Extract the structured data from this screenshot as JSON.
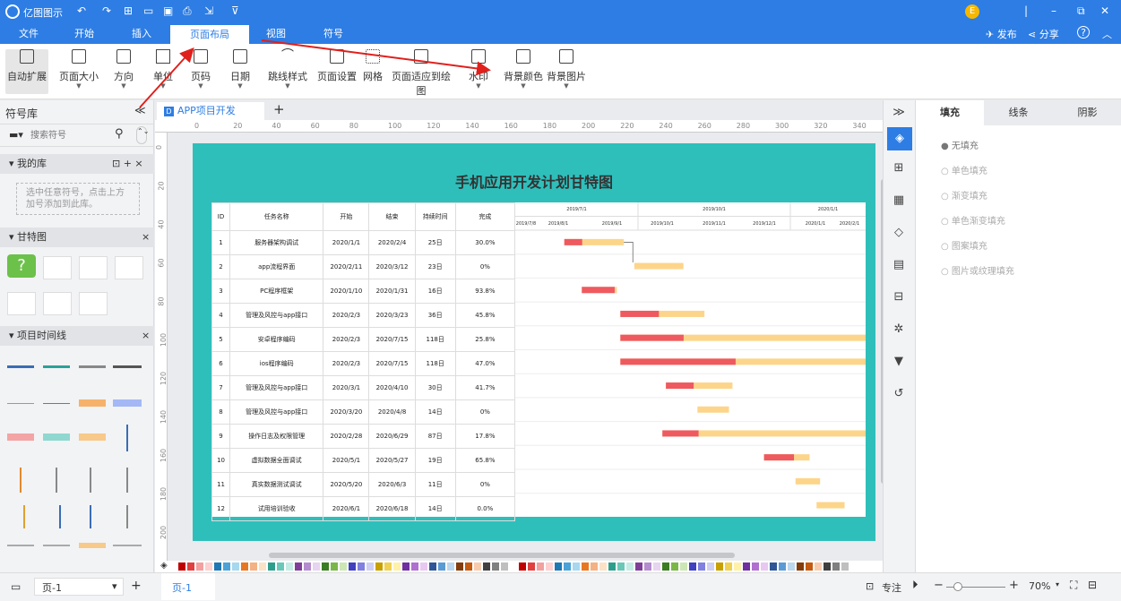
{
  "app": {
    "name": "亿图图示",
    "user_badge": "E",
    "publish": "发布",
    "share": "分享",
    "help": "?"
  },
  "tabs": [
    {
      "label": "文件"
    },
    {
      "label": "开始"
    },
    {
      "label": "插入"
    },
    {
      "label": "页面布局"
    },
    {
      "label": "视图"
    },
    {
      "label": "符号"
    }
  ],
  "ribbon": [
    {
      "label": "自动扩展"
    },
    {
      "label": "页面大小"
    },
    {
      "label": "方向"
    },
    {
      "label": "单位"
    },
    {
      "label": "页码"
    },
    {
      "label": "日期"
    },
    {
      "label": "跳线样式"
    },
    {
      "label": "页面设置"
    },
    {
      "label": "网格"
    },
    {
      "label": "页面适应到绘图"
    },
    {
      "label": "水印"
    },
    {
      "label": "背景颜色"
    },
    {
      "label": "背景图片"
    }
  ],
  "left_panel": {
    "title": "符号库",
    "search_placeholder": "搜索符号",
    "my_library": "我的库",
    "my_library_hint": "选中任意符号，点击上方加号添加到此库。",
    "gantt_section": "甘特图",
    "timeline_section": "项目时间线"
  },
  "doc_tab": "APP项目开发计...",
  "ruler_h": [
    "0",
    "20",
    "40",
    "60",
    "80",
    "100",
    "120",
    "140",
    "160",
    "180",
    "200",
    "220",
    "240",
    "260",
    "280",
    "300",
    "320",
    "340"
  ],
  "ruler_v": [
    "0",
    "20",
    "40",
    "60",
    "80",
    "100",
    "120",
    "140",
    "160",
    "180",
    "200"
  ],
  "gantt": {
    "title": "手机应用开发计划甘特图",
    "headers": [
      "ID",
      "任务名称",
      "开始",
      "结束",
      "持续时间",
      "完成"
    ],
    "top_periods": [
      "2019/7/1",
      "2019/10/1",
      "2020/1/1"
    ],
    "sub_periods": [
      "2019/7/8",
      "2019/8/1",
      "2019/9/1",
      "2019/10/1",
      "2019/11/1",
      "2019/12/1",
      "2020/1/1",
      "2020/2/1"
    ],
    "rows": [
      {
        "id": "1",
        "name": "服务器架构调试",
        "start": "2020/1/1",
        "end": "2020/2/4",
        "dur": "25日",
        "pct": "30.0%",
        "bar": [
          0.14,
          0.31
        ],
        "progress": 0.3
      },
      {
        "id": "2",
        "name": "app流程界面",
        "start": "2020/2/11",
        "end": "2020/3/12",
        "dur": "23日",
        "pct": "0%",
        "bar": [
          0.34,
          0.48
        ],
        "progress": 0
      },
      {
        "id": "3",
        "name": "PC程序框架",
        "start": "2020/1/10",
        "end": "2020/1/31",
        "dur": "16日",
        "pct": "93.8%",
        "bar": [
          0.19,
          0.29
        ],
        "progress": 0.938
      },
      {
        "id": "4",
        "name": "管理及风控与app接口",
        "start": "2020/2/3",
        "end": "2020/3/23",
        "dur": "36日",
        "pct": "45.8%",
        "bar": [
          0.3,
          0.54
        ],
        "progress": 0.458
      },
      {
        "id": "5",
        "name": "安卓程序编码",
        "start": "2020/2/3",
        "end": "2020/7/15",
        "dur": "118日",
        "pct": "25.8%",
        "bar": [
          0.3,
          1.0
        ],
        "progress": 0.258
      },
      {
        "id": "6",
        "name": "ios程序编码",
        "start": "2020/2/3",
        "end": "2020/7/15",
        "dur": "118日",
        "pct": "47.0%",
        "bar": [
          0.3,
          1.0
        ],
        "progress": 0.47
      },
      {
        "id": "7",
        "name": "管理及风控与app接口",
        "start": "2020/3/1",
        "end": "2020/4/10",
        "dur": "30日",
        "pct": "41.7%",
        "bar": [
          0.43,
          0.62
        ],
        "progress": 0.417
      },
      {
        "id": "8",
        "name": "管理及风控与app接口",
        "start": "2020/3/20",
        "end": "2020/4/8",
        "dur": "14日",
        "pct": "0%",
        "bar": [
          0.52,
          0.61
        ],
        "progress": 0
      },
      {
        "id": "9",
        "name": "操作日志及权限管理",
        "start": "2020/2/28",
        "end": "2020/6/29",
        "dur": "87日",
        "pct": "17.8%",
        "bar": [
          0.42,
          1.0
        ],
        "progress": 0.178
      },
      {
        "id": "10",
        "name": "虚拟数据全面调试",
        "start": "2020/5/1",
        "end": "2020/5/27",
        "dur": "19日",
        "pct": "65.8%",
        "bar": [
          0.71,
          0.84
        ],
        "progress": 0.658
      },
      {
        "id": "11",
        "name": "真实数据测试调试",
        "start": "2020/5/20",
        "end": "2020/6/3",
        "dur": "11日",
        "pct": "0%",
        "bar": [
          0.8,
          0.87
        ],
        "progress": 0
      },
      {
        "id": "12",
        "name": "试用培训验收",
        "start": "2020/6/1",
        "end": "2020/6/18",
        "dur": "14日",
        "pct": "0.0%",
        "bar": [
          0.86,
          0.94
        ],
        "progress": 0
      }
    ]
  },
  "right_panel": {
    "tabs": [
      "填充",
      "线条",
      "阴影"
    ],
    "options": [
      "无填充",
      "单色填充",
      "渐变填充",
      "单色渐变填充",
      "图案填充",
      "图片或纹理填充"
    ]
  },
  "status": {
    "page_select": "页-1",
    "page_tab": "页-1",
    "focus": "专注",
    "zoom": "70%"
  },
  "colors": {
    "accent": "#2d7de4",
    "page_bg": "#2fbfbb",
    "bar_done": "#ee5a5f",
    "bar_todo": "#fdd58a",
    "arrow": "#e0201c"
  }
}
